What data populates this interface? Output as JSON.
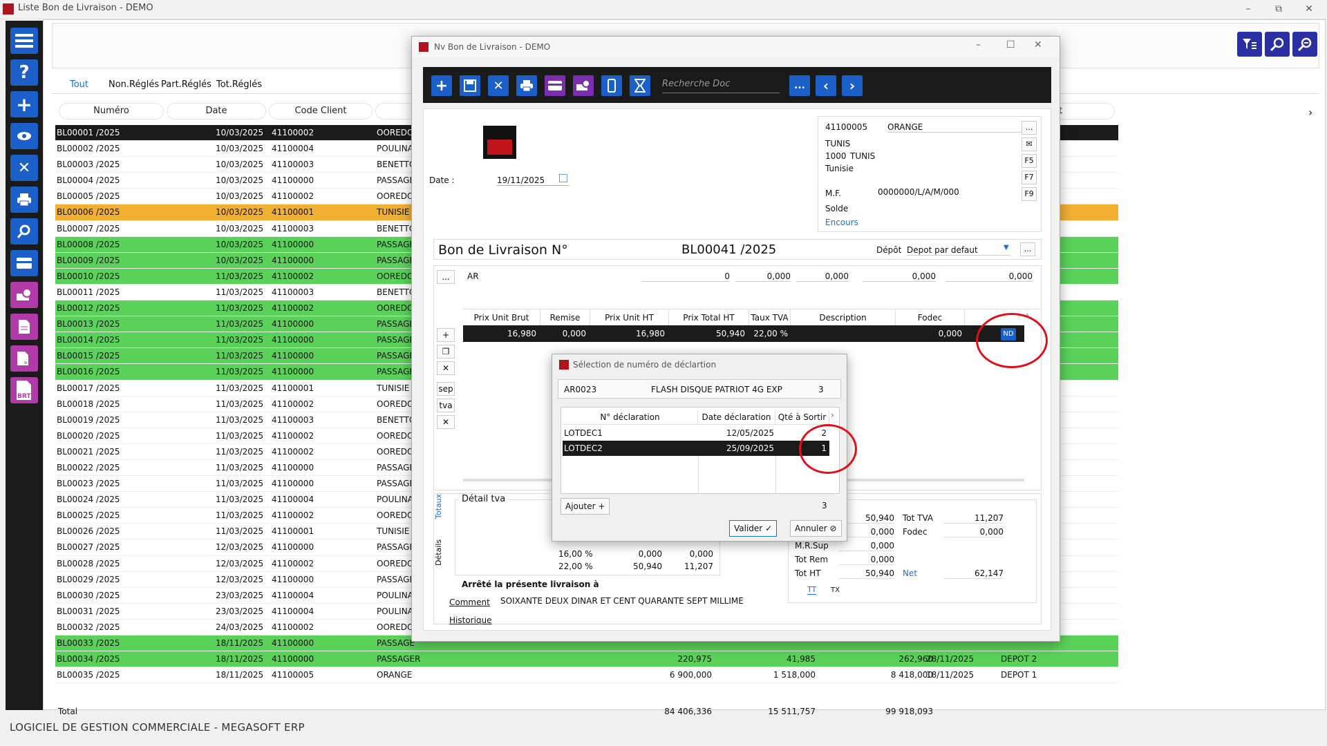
{
  "window": {
    "title": "Liste Bon de Livraison - DEMO"
  },
  "filters": [
    "Tout",
    "Non.Réglés",
    "Part.Réglés",
    "Tot.Réglés"
  ],
  "columns": [
    "Numéro",
    "Date",
    "Code Client",
    "t"
  ],
  "rows": [
    {
      "num": "BL00001 /2025",
      "date": "10/03/2025",
      "code": "41100002",
      "name": "OOREDO",
      "style": "sel"
    },
    {
      "num": "BL00002 /2025",
      "date": "10/03/2025",
      "code": "41100004",
      "name": "POULINA",
      "style": ""
    },
    {
      "num": "BL00003 /2025",
      "date": "10/03/2025",
      "code": "41100003",
      "name": "BENETTO",
      "style": ""
    },
    {
      "num": "BL00004 /2025",
      "date": "10/03/2025",
      "code": "41100000",
      "name": "PASSAGE",
      "style": ""
    },
    {
      "num": "BL00005 /2025",
      "date": "10/03/2025",
      "code": "41100002",
      "name": "OOREDO",
      "style": ""
    },
    {
      "num": "BL00006 /2025",
      "date": "10/03/2025",
      "code": "41100001",
      "name": "TUNISIE",
      "style": "orange"
    },
    {
      "num": "BL00007 /2025",
      "date": "10/03/2025",
      "code": "41100003",
      "name": "BENETTO",
      "style": ""
    },
    {
      "num": "BL00008 /2025",
      "date": "10/03/2025",
      "code": "41100000",
      "name": "PASSAGE",
      "style": "green"
    },
    {
      "num": "BL00009 /2025",
      "date": "10/03/2025",
      "code": "41100000",
      "name": "PASSAGE",
      "style": "green"
    },
    {
      "num": "BL00010 /2025",
      "date": "11/03/2025",
      "code": "41100002",
      "name": "OOREDO",
      "style": "green"
    },
    {
      "num": "BL00011 /2025",
      "date": "11/03/2025",
      "code": "41100003",
      "name": "BENETTO",
      "style": ""
    },
    {
      "num": "BL00012 /2025",
      "date": "11/03/2025",
      "code": "41100002",
      "name": "OOREDO",
      "style": "green"
    },
    {
      "num": "BL00013 /2025",
      "date": "11/03/2025",
      "code": "41100000",
      "name": "PASSAGE",
      "style": "green"
    },
    {
      "num": "BL00014 /2025",
      "date": "11/03/2025",
      "code": "41100000",
      "name": "PASSAGE",
      "style": "green"
    },
    {
      "num": "BL00015 /2025",
      "date": "11/03/2025",
      "code": "41100000",
      "name": "PASSAGE",
      "style": "green"
    },
    {
      "num": "BL00016 /2025",
      "date": "11/03/2025",
      "code": "41100000",
      "name": "PASSAGE",
      "style": "green"
    },
    {
      "num": "BL00017 /2025",
      "date": "11/03/2025",
      "code": "41100001",
      "name": "TUNISIE",
      "style": ""
    },
    {
      "num": "BL00018 /2025",
      "date": "11/03/2025",
      "code": "41100002",
      "name": "OOREDO",
      "style": ""
    },
    {
      "num": "BL00019 /2025",
      "date": "11/03/2025",
      "code": "41100003",
      "name": "BENETTO",
      "style": ""
    },
    {
      "num": "BL00020 /2025",
      "date": "11/03/2025",
      "code": "41100002",
      "name": "OOREDO",
      "style": ""
    },
    {
      "num": "BL00021 /2025",
      "date": "11/03/2025",
      "code": "41100002",
      "name": "OOREDO",
      "style": ""
    },
    {
      "num": "BL00022 /2025",
      "date": "11/03/2025",
      "code": "41100000",
      "name": "PASSAGE",
      "style": ""
    },
    {
      "num": "BL00023 /2025",
      "date": "11/03/2025",
      "code": "41100000",
      "name": "PASSAGE",
      "style": ""
    },
    {
      "num": "BL00024 /2025",
      "date": "11/03/2025",
      "code": "41100004",
      "name": "POULINA",
      "style": ""
    },
    {
      "num": "BL00025 /2025",
      "date": "11/03/2025",
      "code": "41100002",
      "name": "OOREDO",
      "style": ""
    },
    {
      "num": "BL00026 /2025",
      "date": "11/03/2025",
      "code": "41100001",
      "name": "TUNISIE",
      "style": ""
    },
    {
      "num": "BL00027 /2025",
      "date": "12/03/2025",
      "code": "41100000",
      "name": "PASSAGE",
      "style": ""
    },
    {
      "num": "BL00028 /2025",
      "date": "12/03/2025",
      "code": "41100002",
      "name": "OOREDO",
      "style": ""
    },
    {
      "num": "BL00029 /2025",
      "date": "12/03/2025",
      "code": "41100000",
      "name": "PASSAGE",
      "style": ""
    },
    {
      "num": "BL00030 /2025",
      "date": "23/03/2025",
      "code": "41100004",
      "name": "POULINA",
      "style": ""
    },
    {
      "num": "BL00031 /2025",
      "date": "23/03/2025",
      "code": "41100004",
      "name": "POULINA",
      "style": ""
    },
    {
      "num": "BL00032 /2025",
      "date": "24/03/2025",
      "code": "41100002",
      "name": "OOREDO",
      "style": ""
    },
    {
      "num": "BL00033 /2025",
      "date": "18/11/2025",
      "code": "41100000",
      "name": "PASSAGE",
      "style": "green"
    },
    {
      "num": "BL00034 /2025",
      "date": "18/11/2025",
      "code": "41100000",
      "name": "PASSAGER",
      "style": "green",
      "a": "220,975",
      "b": "41,985",
      "c": "262,960",
      "d": "28/11/2025",
      "e": "DEPOT 2"
    },
    {
      "num": "BL00035 /2025",
      "date": "18/11/2025",
      "code": "41100005",
      "name": "ORANGE",
      "style": "",
      "a": "6 900,000",
      "b": "1 518,000",
      "c": "8 418,000",
      "d": "18/11/2025",
      "e": "DEPOT 1"
    }
  ],
  "total": {
    "label": "Total",
    "a": "84 406,336",
    "b": "15 511,757",
    "c": "99 918,093"
  },
  "footer": "LOGICIEL DE GESTION COMMERCIALE - MEGASOFT ERP",
  "dialog": {
    "title": "Nv Bon de Livraison - DEMO",
    "search_placeholder": "Recherche Doc",
    "date_label": "Date :",
    "date": "19/11/2025",
    "client": {
      "code": "41100005",
      "name": "ORANGE",
      "city": "TUNIS",
      "zip": "1000",
      "city2": "TUNIS",
      "country": "Tunisie",
      "mf_label": "M.F.",
      "mf": "0000000/L/A/M/000",
      "solde": "Solde",
      "encours": "Encours"
    },
    "fkeys": [
      "F5",
      "F7",
      "F9"
    ],
    "bl_label": "Bon de Livraison N°",
    "bl_num": "BL00041 /2025",
    "depot_label": "Dépôt",
    "depot": "Depot par defaut",
    "line_head": {
      "code": "AR",
      "q": "0",
      "v1": "0,000",
      "v2": "0,000",
      "v3": "0,000",
      "v4": "0,000"
    },
    "grid_headers": [
      "Prix Unit Brut",
      "Remise",
      "Prix Unit HT",
      "Prix Total HT",
      "Taux TVA",
      "Description",
      "Fodec"
    ],
    "grid_row": {
      "pub": "16,980",
      "remise": "0,000",
      "puht": "16,980",
      "pth": "50,940",
      "tva": "22,00 %",
      "fodec": "0,000",
      "nd": "ND"
    },
    "side_labels": [
      "sep",
      "tva"
    ],
    "tabs": [
      "Totaux",
      "Détails"
    ],
    "detail_tva": "Détail tva",
    "tva_rows": [
      {
        "t": "16,00 %",
        "a": "0,000",
        "b": "0,000"
      },
      {
        "t": "22,00 %",
        "a": "50,940",
        "b": "11,207"
      }
    ],
    "arrete": "Arrêté la présente livraison à",
    "comment": "Comment",
    "historique": "Historique",
    "amount_words": "SOIXANTE DEUX DINAR ET CENT QUARANTE SEPT MILLIME",
    "totals": {
      "tothtb": "50,940",
      "tottva_l": "Tot TVA",
      "tottva": "11,207",
      "r2": "0,000",
      "fodec_l": "Fodec",
      "fodec": "0,000",
      "mrsup_l": "M.R.Sup",
      "mrsup": "0,000",
      "totrem_l": "Tot Rem",
      "totrem": "0,000",
      "totht_l": "Tot HT",
      "totht": "50,940",
      "net_l": "Net",
      "net": "62,147",
      "tt": "TT",
      "tx": "TX"
    }
  },
  "sub": {
    "title": "Sélection de numéro de déclartion",
    "code": "AR0023",
    "designation": "FLASH DISQUE PATRIOT 4G EXP",
    "qty": "3",
    "headers": [
      "N° déclaration",
      "Date déclaration",
      "Qté à Sortir"
    ],
    "rows": [
      {
        "n": "LOTDEC1",
        "d": "12/05/2025",
        "q": "2"
      },
      {
        "n": "LOTDEC2",
        "d": "25/09/2025",
        "q": "1"
      }
    ],
    "ajouter": "Ajouter",
    "total": "3",
    "valider": "Valider",
    "annuler": "Annuler"
  }
}
